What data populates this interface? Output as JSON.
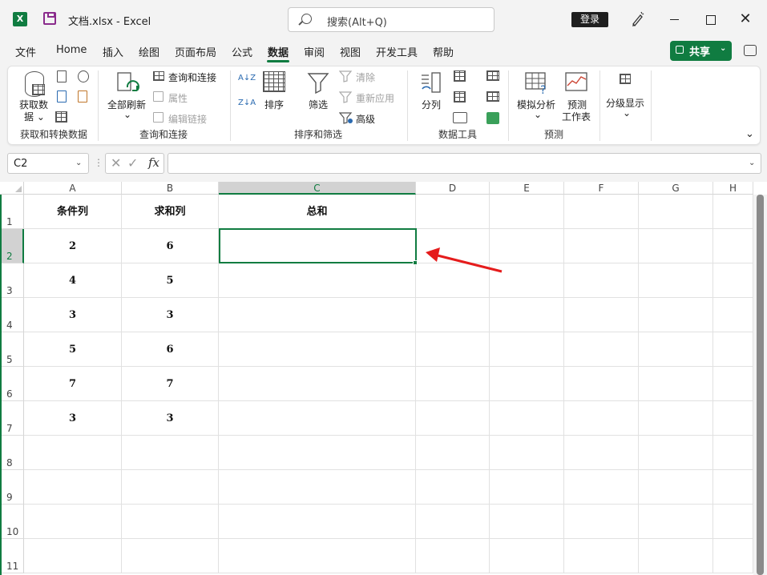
{
  "app": {
    "title": "文档.xlsx  -  Excel",
    "logo": "X"
  },
  "search": {
    "placeholder": "搜索(Alt+Q)"
  },
  "titlebar": {
    "login_label": "登录",
    "close_glyph": "✕"
  },
  "tabs": [
    {
      "label": "文件"
    },
    {
      "label": "Home"
    },
    {
      "label": "插入"
    },
    {
      "label": "绘图"
    },
    {
      "label": "页面布局"
    },
    {
      "label": "公式"
    },
    {
      "label": "数据",
      "active": true
    },
    {
      "label": "审阅"
    },
    {
      "label": "视图"
    },
    {
      "label": "开发工具"
    },
    {
      "label": "帮助"
    }
  ],
  "share": {
    "label": "共享",
    "chevron": "⌄"
  },
  "ribbon": {
    "get_data": "获取数",
    "get_data2": "据 ⌄",
    "group_get": "获取和转换数据",
    "refresh_all": "全部刷新",
    "refresh_chev": "⌄",
    "queries": "查询和连接",
    "properties": "属性",
    "edit_links": "编辑链接",
    "group_queries": "查询和连接",
    "sort_az": "A↓Z",
    "sort_za": "Z↓A",
    "sort": "排序",
    "filter": "筛选",
    "clear": "清除",
    "reapply": "重新应用",
    "advanced": "高级",
    "group_sort": "排序和筛选",
    "text_to_columns": "分列",
    "group_tools": "数据工具",
    "whatif": "模拟分析",
    "whatif_chev": "⌄",
    "forecast1": "预测",
    "forecast2": "工作表",
    "group_forecast": "预测",
    "outline": "分级显示",
    "outline_chev": "⌄",
    "collapse": "⌄"
  },
  "formula_bar": {
    "name_box": "C2",
    "cancel": "✕",
    "enter": "✓",
    "fx": "fx",
    "dots": "⋮",
    "formula": ""
  },
  "columns": [
    "A",
    "B",
    "C",
    "D",
    "E",
    "F",
    "G",
    "H"
  ],
  "rows": [
    "1",
    "2",
    "3",
    "4",
    "5",
    "6",
    "7",
    "8",
    "9",
    "10",
    "11"
  ],
  "cells": {
    "A1": "条件列",
    "B1": "求和列",
    "C1": "总和",
    "A2": "2",
    "B2": "6",
    "A3": "4",
    "B3": "5",
    "A4": "3",
    "B4": "3",
    "A5": "5",
    "B5": "6",
    "A6": "7",
    "B6": "7",
    "A7": "3",
    "B7": "3"
  },
  "selected_cell": "C2",
  "colors": {
    "accent": "#107c41",
    "arrow": "#e51c1c"
  }
}
